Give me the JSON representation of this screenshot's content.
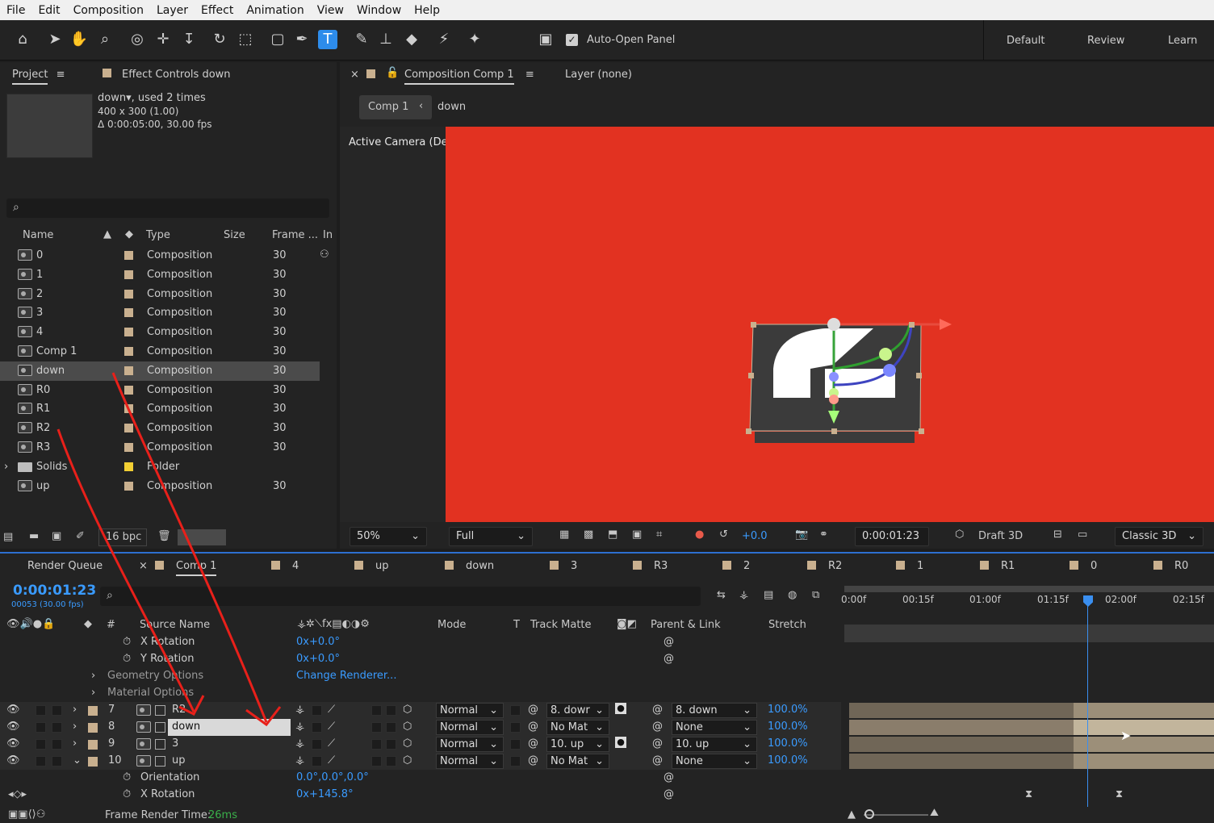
{
  "menu": [
    "File",
    "Edit",
    "Composition",
    "Layer",
    "Effect",
    "Animation",
    "View",
    "Window",
    "Help"
  ],
  "toolbar": {
    "auto_open_panel": "Auto-Open Panel",
    "workspaces": [
      "Default",
      "Review",
      "Learn"
    ],
    "icons": [
      "home-icon",
      "selection-icon",
      "hand-icon",
      "zoom-icon",
      "orbit-icon",
      "pan-icon",
      "dolly-icon",
      "rotate-icon",
      "anchor-icon",
      "rectangle-icon",
      "pen-icon",
      "type-icon",
      "brush-icon",
      "clone-stamp-icon",
      "eraser-icon",
      "roto-brush-icon",
      "puppet-icon"
    ]
  },
  "project": {
    "tab": "Project",
    "effect_controls_tab": "Effect Controls down",
    "info_name": "down",
    "info_used": ", used 2 times",
    "info_dims": "400 x 300 (1.00)",
    "info_duration": "Δ 0:00:05:00, 30.00 fps",
    "columns": {
      "name": "Name",
      "type": "Type",
      "size": "Size",
      "frame": "Frame ...",
      "in": "In"
    },
    "items": [
      {
        "name": "0",
        "type": "Composition",
        "frame": "30"
      },
      {
        "name": "1",
        "type": "Composition",
        "frame": "30"
      },
      {
        "name": "2",
        "type": "Composition",
        "frame": "30"
      },
      {
        "name": "3",
        "type": "Composition",
        "frame": "30"
      },
      {
        "name": "4",
        "type": "Composition",
        "frame": "30"
      },
      {
        "name": "Comp 1",
        "type": "Composition",
        "frame": "30"
      },
      {
        "name": "down",
        "type": "Composition",
        "frame": "30"
      },
      {
        "name": "R0",
        "type": "Composition",
        "frame": "30"
      },
      {
        "name": "R1",
        "type": "Composition",
        "frame": "30"
      },
      {
        "name": "R2",
        "type": "Composition",
        "frame": "30"
      },
      {
        "name": "R3",
        "type": "Composition",
        "frame": "30"
      },
      {
        "name": "Solids",
        "type": "Folder",
        "frame": ""
      },
      {
        "name": "up",
        "type": "Composition",
        "frame": "30"
      }
    ],
    "bpc": "16 bpc"
  },
  "composition": {
    "tab": "Composition Comp 1",
    "layer_tab": "Layer (none)",
    "breadcrumb_comp": "Comp 1",
    "breadcrumb_layer": "down",
    "camera_label": "Active Camera (Default)",
    "bg_color": "#e23221",
    "zoom": "50%",
    "resolution": "Full",
    "exposure": "+0.0",
    "timecode": "0:00:01:23",
    "draft3d": "Draft 3D",
    "renderer": "Classic 3D"
  },
  "timeline": {
    "tabs": [
      "Render Queue",
      "Comp 1",
      "4",
      "up",
      "down",
      "3",
      "R3",
      "2",
      "R2",
      "1",
      "R1",
      "0",
      "R0"
    ],
    "timecode": "0:00:01:23",
    "frame_info": "00053 (30.00 fps)",
    "columns": {
      "source": "Source Name",
      "mode": "Mode",
      "t": "T",
      "track_matte": "Track Matte",
      "parent": "Parent & Link",
      "stretch": "Stretch"
    },
    "ruler": [
      "0:00f",
      "00:15f",
      "01:00f",
      "01:15f",
      "02:00f",
      "02:15f"
    ],
    "props_top": [
      {
        "label": "X Rotation",
        "value": "0x+0.0°"
      },
      {
        "label": "Y Rotation",
        "value": "0x+0.0°"
      },
      {
        "label": "Geometry Options",
        "value": "Change Renderer..."
      },
      {
        "label": "Material Options",
        "value": ""
      }
    ],
    "layers": [
      {
        "num": "7",
        "name": "R2",
        "mode": "Normal",
        "matte": "8. dowr",
        "parent": "8. down",
        "stretch": "100.0%"
      },
      {
        "num": "8",
        "name": "down",
        "mode": "Normal",
        "matte": "No Mat",
        "parent": "None",
        "stretch": "100.0%"
      },
      {
        "num": "9",
        "name": "3",
        "mode": "Normal",
        "matte": "10. up",
        "parent": "10. up",
        "stretch": "100.0%"
      },
      {
        "num": "10",
        "name": "up",
        "mode": "Normal",
        "matte": "No Mat",
        "parent": "None",
        "stretch": "100.0%"
      }
    ],
    "props_bottom": [
      {
        "label": "Orientation",
        "value": "0.0°,0.0°,0.0°"
      },
      {
        "label": "X Rotation",
        "value": "0x+145.8°"
      }
    ],
    "frame_render_label": "Frame Render Time:",
    "frame_render_value": "26ms"
  }
}
